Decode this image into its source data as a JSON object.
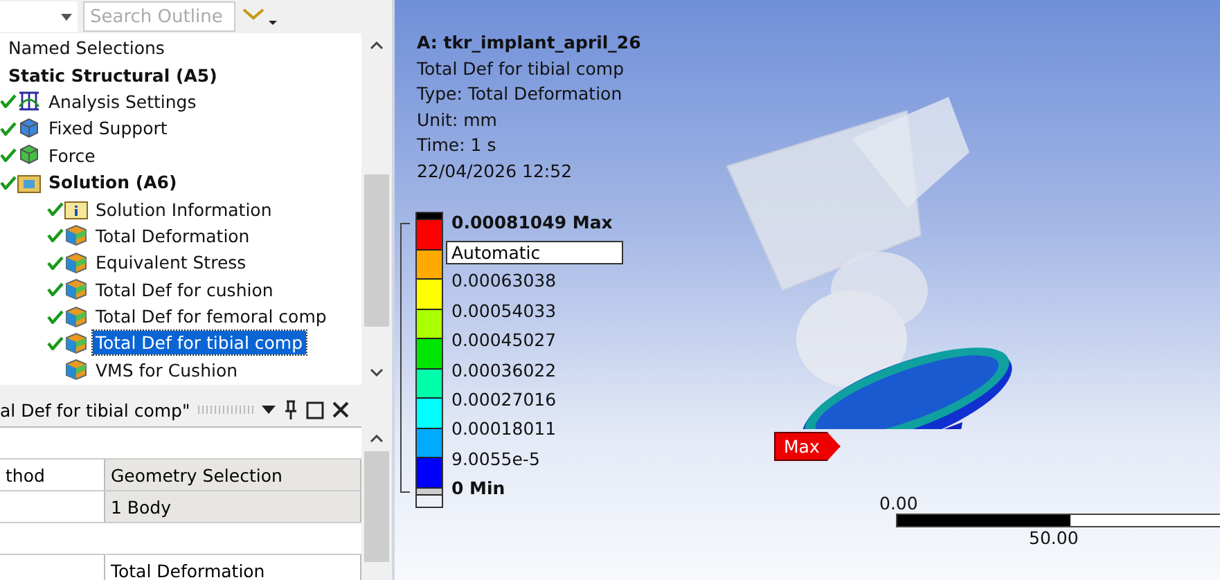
{
  "outline_toolbar": {
    "search": {
      "placeholder": "Search Outline"
    }
  },
  "tree": [
    {
      "label": "Named Selections",
      "bold": false,
      "checked": false,
      "selected": false
    },
    {
      "label": "Static Structural (A5)",
      "bold": true,
      "checked": false,
      "selected": false,
      "children": [
        {
          "label": "Analysis Settings",
          "kind": "settings",
          "bold": false,
          "checked": true,
          "selected": false
        },
        {
          "label": "Fixed Support",
          "kind": "support",
          "bold": false,
          "checked": true,
          "selected": false
        },
        {
          "label": "Force",
          "kind": "force",
          "bold": false,
          "checked": true,
          "selected": false
        },
        {
          "label": "Solution (A6)",
          "kind": "solution",
          "bold": true,
          "checked": true,
          "selected": false,
          "children": [
            {
              "label": "Solution Information",
              "kind": "info",
              "bold": false,
              "checked": true,
              "selected": false
            },
            {
              "label": "Total Deformation",
              "kind": "result",
              "bold": false,
              "checked": true,
              "selected": false
            },
            {
              "label": "Equivalent Stress",
              "kind": "result",
              "bold": false,
              "checked": true,
              "selected": false
            },
            {
              "label": "Total Def for cushion",
              "kind": "result",
              "bold": false,
              "checked": true,
              "selected": false
            },
            {
              "label": "Total Def for femoral comp",
              "kind": "result",
              "bold": false,
              "checked": true,
              "selected": false
            },
            {
              "label": "Total Def for tibial comp",
              "kind": "result",
              "bold": false,
              "checked": true,
              "selected": true
            },
            {
              "label": "VMS for Cushion",
              "kind": "result",
              "bold": false,
              "checked": false,
              "selected": false
            }
          ]
        }
      ]
    }
  ],
  "details": {
    "title": "al Def for tibial comp\"",
    "rows": [
      {
        "kind": "section"
      },
      {
        "kind": "group",
        "label": "thod",
        "value": "Geometry Selection"
      },
      {
        "kind": "group",
        "value": "1 Body"
      },
      {
        "kind": "section"
      },
      {
        "kind": "data",
        "value": "Total Deformation"
      }
    ]
  },
  "viewport": {
    "info": [
      "A: tkr_implant_april_26",
      "Total Def for tibial comp",
      "Type: Total Deformation",
      "Unit: mm",
      "Time: 1 s",
      "22/04/2026 12:52"
    ],
    "legend": {
      "max": "0.00081049 Max",
      "mode": "Automatic",
      "min": "0 Min",
      "bands": [
        {
          "color": "#ff0000"
        },
        {
          "color": "#ffaa00"
        },
        {
          "color": "#ffff00"
        },
        {
          "color": "#aaff00"
        },
        {
          "color": "#00e600"
        },
        {
          "color": "#00ffaa"
        },
        {
          "color": "#00ffff"
        },
        {
          "color": "#00aaff"
        },
        {
          "color": "#0000ff"
        }
      ],
      "values": [
        "0.00063038",
        "0.00054033",
        "0.00045027",
        "0.00036022",
        "0.00027016",
        "0.00018011",
        "9.0055e-5"
      ]
    },
    "probe": "Max",
    "scale": {
      "start": "0.00",
      "mid": "50.00"
    }
  }
}
